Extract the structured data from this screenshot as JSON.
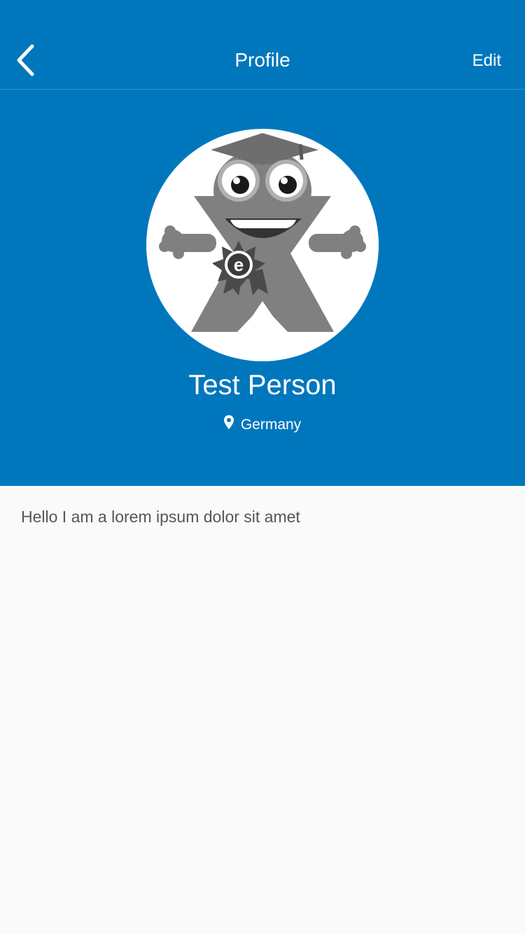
{
  "nav": {
    "title": "Profile",
    "edit_label": "Edit"
  },
  "profile": {
    "name": "Test Person",
    "location": "Germany",
    "bio": "Hello I am a lorem ipsum dolor sit amet",
    "avatar_badge_letter": "e"
  },
  "colors": {
    "primary": "#0077bd",
    "background": "#fafafa",
    "text_muted": "#555555"
  },
  "icons": {
    "back": "chevron-left-icon",
    "location": "map-pin-icon"
  }
}
